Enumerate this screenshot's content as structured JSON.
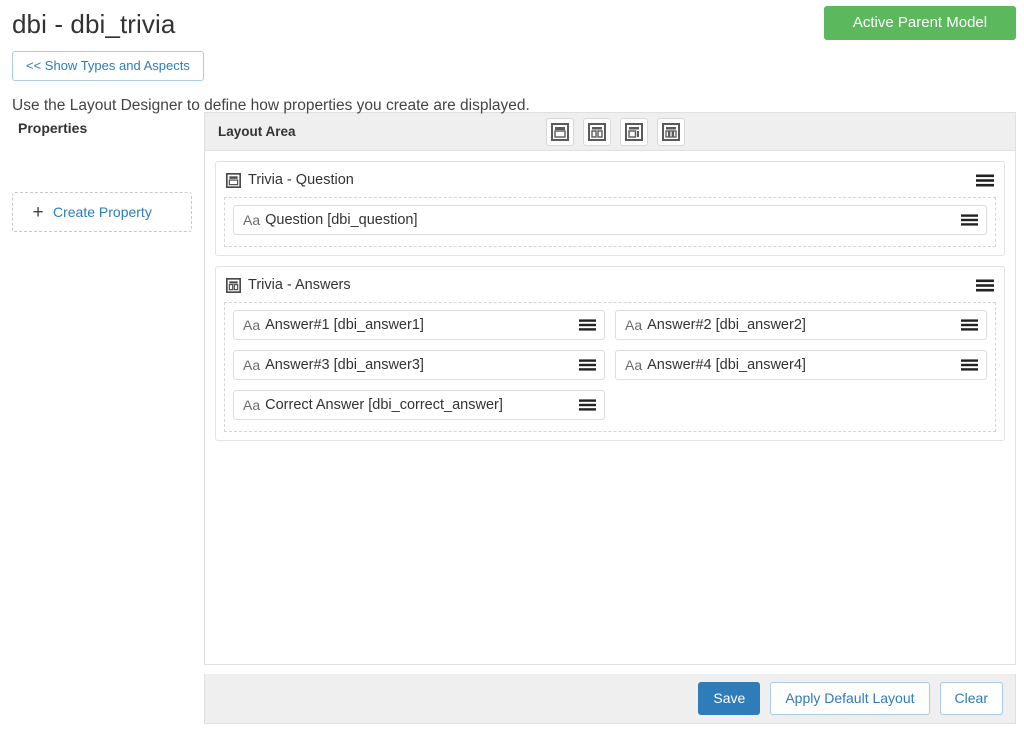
{
  "header": {
    "title": "dbi - dbi_trivia",
    "status_badge": "Active Parent Model",
    "status_badge_color": "#5cb85c",
    "show_types_button": "<< Show Types and Aspects",
    "intro_text": "Use the Layout Designer to define how properties you create are displayed."
  },
  "properties_panel": {
    "title": "Properties",
    "create_property_label": "Create Property",
    "plus_glyph": "+"
  },
  "layout_area": {
    "title": "Layout Area",
    "tools": [
      {
        "name": "single-column-layout-icon",
        "title": "Single column"
      },
      {
        "name": "two-equal-columns-layout-icon",
        "title": "Two equal columns"
      },
      {
        "name": "wide-narrow-columns-layout-icon",
        "title": "Wide and narrow columns"
      },
      {
        "name": "three-columns-layout-icon",
        "title": "Three columns"
      }
    ],
    "sections": [
      {
        "title": "Trivia - Question",
        "icon": "single-column-layout-icon",
        "columns": 1,
        "fields": [
          {
            "prefix": "Aa",
            "label": "Question [dbi_question]",
            "width": "full"
          }
        ]
      },
      {
        "title": "Trivia - Answers",
        "icon": "two-equal-columns-layout-icon",
        "columns": 2,
        "fields": [
          {
            "prefix": "Aa",
            "label": "Answer#1 [dbi_answer1]",
            "width": "half"
          },
          {
            "prefix": "Aa",
            "label": "Answer#2 [dbi_answer2]",
            "width": "half"
          },
          {
            "prefix": "Aa",
            "label": "Answer#3 [dbi_answer3]",
            "width": "half"
          },
          {
            "prefix": "Aa",
            "label": "Answer#4 [dbi_answer4]",
            "width": "half"
          },
          {
            "prefix": "Aa",
            "label": "Correct Answer [dbi_correct_answer]",
            "width": "half"
          }
        ]
      }
    ]
  },
  "footer": {
    "save_label": "Save",
    "apply_default_layout_label": "Apply Default Layout",
    "clear_label": "Clear",
    "primary_color": "#2e7cba"
  }
}
